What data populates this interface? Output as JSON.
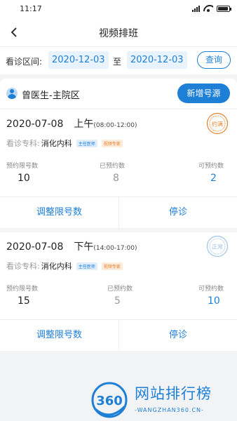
{
  "status_bar": {
    "time": "11:17"
  },
  "nav": {
    "title": "视频排班"
  },
  "filter": {
    "label": "看诊区间:",
    "start_date": "2020-12-03",
    "separator": "至",
    "end_date": "2020-12-03",
    "query_label": "查询"
  },
  "doctor": {
    "name": "曾医生-主院区",
    "add_label": "新增号源"
  },
  "labels": {
    "dept_label": "看诊专科:",
    "limit": "预约限号数",
    "booked": "已预约数",
    "available": "可预约数",
    "adjust": "调整限号数",
    "stop": "停诊"
  },
  "schedules": [
    {
      "date": "2020-07-08",
      "period": "上午",
      "hours": "(08:00-12:00)",
      "dept": "消化内科",
      "tag1": "主任医师",
      "tag2": "视频专家",
      "limit": "10",
      "booked": "8",
      "available": "2",
      "stamp_text": "约满",
      "stamp_color": "#e6822c"
    },
    {
      "date": "2020-07-08",
      "period": "下午",
      "hours": "(14:00-17:00)",
      "dept": "消化内科",
      "tag1": "主任医师",
      "tag2": "视频专家",
      "limit": "15",
      "booked": "5",
      "available": "10",
      "stamp_text": "正常",
      "stamp_color": "#9fc3e6"
    }
  ],
  "watermark": {
    "logo_text": "360",
    "title": "网站排行榜",
    "subtitle": "-WANGZHAN360.CN-"
  },
  "colors": {
    "accent": "#1d7fd6",
    "background": "#f2f3f5"
  }
}
